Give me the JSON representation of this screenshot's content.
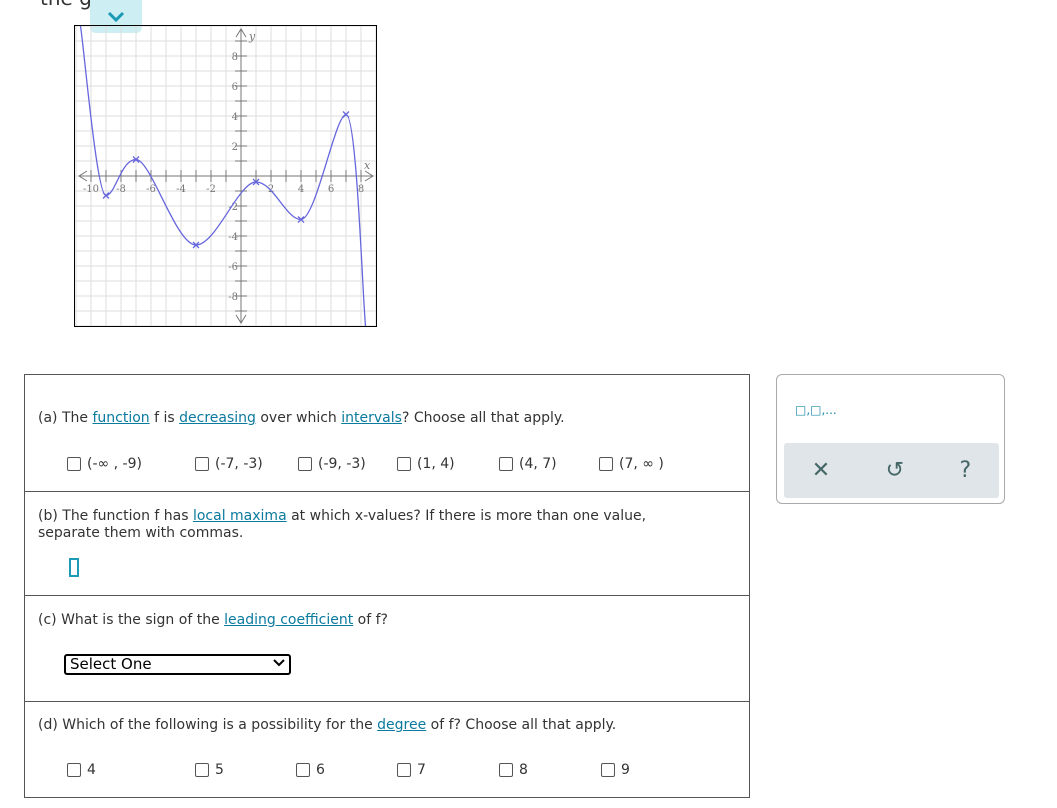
{
  "top_text": "the gra",
  "graph": {
    "x_ticks": [
      "-10",
      "-8",
      "-6",
      "-4",
      "-2",
      "2",
      "4",
      "6",
      "8"
    ],
    "y_ticks": [
      "8",
      "6",
      "4",
      "2",
      "-2",
      "-4",
      "-6",
      "-8"
    ],
    "x_label": "x",
    "y_label": "y",
    "curve_color": "#6666dd"
  },
  "chart_data": {
    "type": "line",
    "xlim": [
      -11,
      9
    ],
    "ylim": [
      -10,
      10
    ],
    "grid": true,
    "xlabel": "x",
    "ylabel": "y",
    "marked_points": [
      {
        "x": -9,
        "y": -1.3
      },
      {
        "x": -7,
        "y": 1.1
      },
      {
        "x": -3,
        "y": -4.6
      },
      {
        "x": 1,
        "y": -0.4
      },
      {
        "x": 4,
        "y": -2.9
      },
      {
        "x": 7,
        "y": 4.1
      }
    ],
    "curve_points": [
      {
        "x": -10.7,
        "y": 10
      },
      {
        "x": -9,
        "y": -1.3
      },
      {
        "x": -7,
        "y": 1.1
      },
      {
        "x": -3,
        "y": -4.6
      },
      {
        "x": 1,
        "y": -0.4
      },
      {
        "x": 4,
        "y": -2.9
      },
      {
        "x": 7,
        "y": 4.1
      },
      {
        "x": 8.3,
        "y": -10
      }
    ]
  },
  "a": {
    "pre": "(a) The ",
    "l1": "function",
    "m1": " f is ",
    "l2": "decreasing",
    "m2": " over which ",
    "l3": "intervals",
    "post": "? Choose all that apply.",
    "options": [
      "(-∞ , -9)",
      "(-7, -3)",
      "(-9, -3)",
      "(1, 4)",
      "(4, 7)",
      "(7, ∞ )"
    ]
  },
  "b": {
    "pre": "(b) The function f has ",
    "l1": "local maxima",
    "post": " at which x-values? If there is more than one value, separate them with commas.",
    "value": ""
  },
  "c": {
    "pre": "(c) What is the sign of the ",
    "l1": "leading coefficient",
    "post": " of f?",
    "select": "Select One"
  },
  "d": {
    "pre": "(d) Which of the following is a possibility for the ",
    "l1": "degree",
    "post": " of f? Choose all that apply.",
    "options": [
      "4",
      "5",
      "6",
      "7",
      "8",
      "9"
    ]
  },
  "tools": {
    "template": "□,□,...",
    "clear": "✕",
    "undo": "↺",
    "help": "?"
  }
}
